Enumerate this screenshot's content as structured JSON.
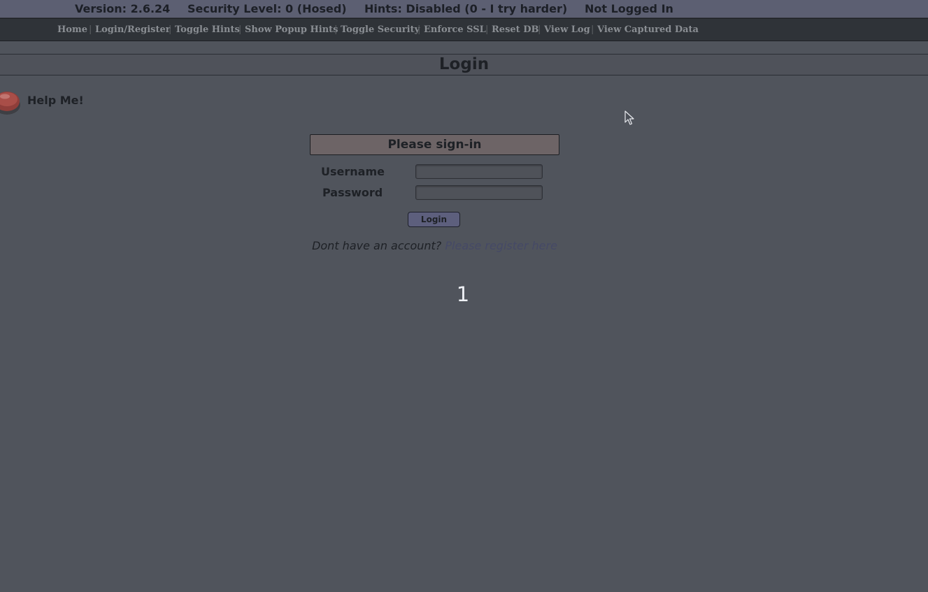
{
  "status_bar": {
    "version": "Version: 2.6.24",
    "security": "Security Level: 0 (Hosed)",
    "hints": "Hints: Disabled (0 - I try harder)",
    "login_state": "Not Logged In"
  },
  "menu": {
    "items": [
      {
        "label": "Home"
      },
      {
        "label": "Login/Register"
      },
      {
        "label": "Toggle Hints"
      },
      {
        "label": "Show Popup Hints"
      },
      {
        "label": "Toggle Security"
      },
      {
        "label": "Enforce SSL"
      },
      {
        "label": "Reset DB"
      },
      {
        "label": "View Log"
      },
      {
        "label": "View Captured Data"
      }
    ],
    "separator": "|"
  },
  "page": {
    "title": "Login"
  },
  "help": {
    "label": "Help Me!",
    "icon": "red-help-button-icon"
  },
  "login_form": {
    "header": "Please sign-in",
    "username_label": "Username",
    "username_value": "",
    "password_label": "Password",
    "password_value": "",
    "submit_label": "Login",
    "register_prompt": "Dont have an account?",
    "register_link": "Please register here"
  },
  "overlay": {
    "counter": "1"
  },
  "colors": {
    "background": "#50545c",
    "status_bar": "#5c5f72",
    "menu_bar": "#2f3338",
    "signin_header": "#6d6466",
    "login_button": "#5d5f7d",
    "register_link": "#454966"
  }
}
